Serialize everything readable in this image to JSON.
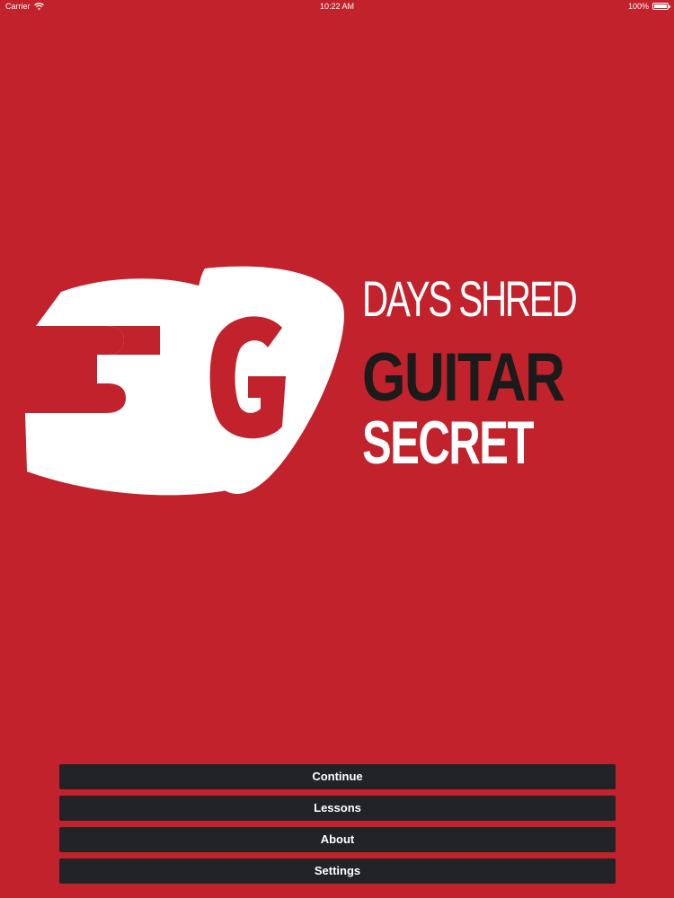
{
  "status_bar": {
    "carrier": "Carrier",
    "time": "10:22 AM",
    "battery": "100%",
    "icons": [
      "wifi-icon",
      "battery-icon"
    ]
  },
  "logo": {
    "mark_text": "3G",
    "line1": "DAYS SHRED",
    "line2": "GUITAR",
    "line3": "SECRET"
  },
  "menu": {
    "items": [
      {
        "label": "Continue"
      },
      {
        "label": "Lessons"
      },
      {
        "label": "About"
      },
      {
        "label": "Settings"
      }
    ]
  },
  "colors": {
    "background": "#c1222b",
    "button": "#222327",
    "logo_white": "#ffffff",
    "logo_dark": "#1b1b1b"
  }
}
